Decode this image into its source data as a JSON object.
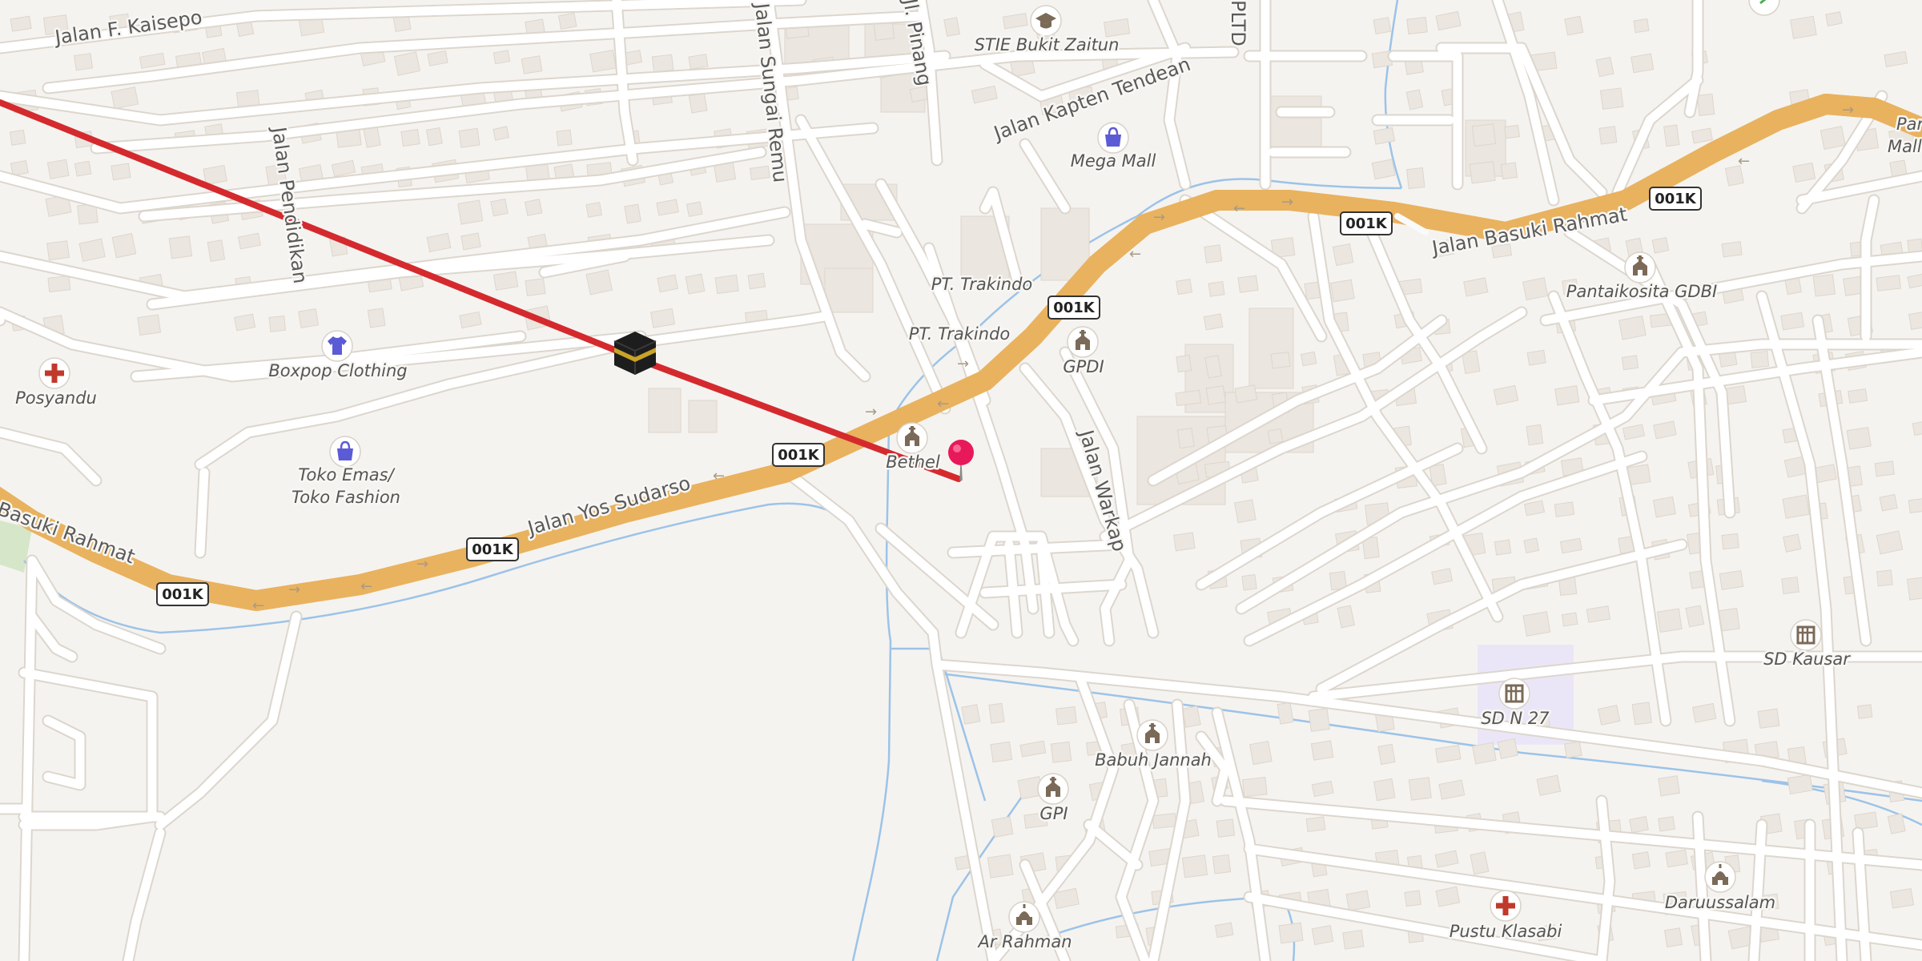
{
  "map": {
    "colors": {
      "background": "#f5f3f0",
      "minor_road": "#ffffff",
      "major_road_fill": "#f7d38a",
      "major_road_casing": "#e9b25f",
      "building": "#ebe6df",
      "water": "#8fbde6",
      "route_line": "#d42a2e",
      "pin": "#e8195a",
      "amenity_icon": "#7b6a57",
      "health_icon": "#c0392b",
      "shop_icon": "#5b5bd6",
      "school_area": "#ebe6f7"
    },
    "road_shield": "001K",
    "streets": {
      "kaisepo": "Jalan F. Kaisepo",
      "sungai_remu": "Jalan Sungai Remu",
      "pinang": "Jl. Pinang",
      "pltd": "PLTD",
      "kapten_tendean": "Jalan Kapten Tendean",
      "pendidikan": "Jalan Pendidikan",
      "basuki_rahmat_east": "Jalan Basuki Rahmat",
      "basuki_rahmat_west": "Basuki Rahmat",
      "yos_sudarso": "Jalan Yos Sudarso",
      "warkap": "Jalan Warkap"
    },
    "pois": {
      "stie": "STIE Bukit Zaitun",
      "mega_mall": "Mega Mall",
      "pt_trakindo_1": "PT. Trakindo",
      "pt_trakindo_2": "PT. Trakindo",
      "gpdi": "GPDI",
      "pantaikosita": "Pantaikosita GDBI",
      "boxpop": "Boxpop Clothing",
      "posyandu": "Posyandu",
      "toko_emas_1": "Toko Emas/",
      "toko_emas_2": "Toko Fashion",
      "bethel": "Bethel",
      "sd_kausar": "SD Kausar",
      "sd_n27": "SD N 27",
      "babuh_jannah": "Babuh Jannah",
      "gpi": "GPI",
      "ar_rahman": "Ar Rahman",
      "pustu": "Pustu Klasabi",
      "daruussalam": "Daruussalam",
      "mall_partial_1": "Par",
      "mall_partial_2": "Mall"
    }
  }
}
